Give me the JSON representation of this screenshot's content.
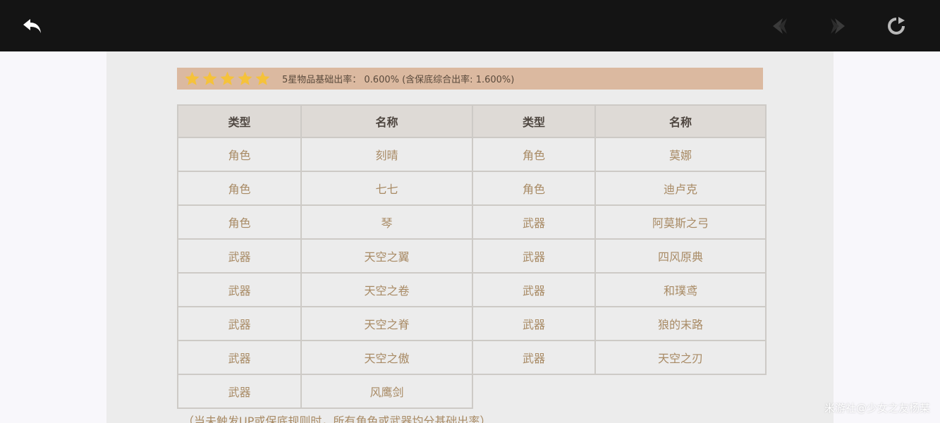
{
  "toolbar": {
    "back_icon": "back-arrow-icon",
    "prev_icon": "prev-arrow-icon",
    "next_icon": "next-arrow-icon",
    "refresh_icon": "refresh-icon"
  },
  "banner": {
    "stars": 5,
    "star_color": "#f5c23a",
    "text": "5星物品基础出率： 0.600% (含保底综合出率: 1.600%)"
  },
  "table": {
    "headers": [
      "类型",
      "名称",
      "类型",
      "名称"
    ],
    "rows": [
      [
        "角色",
        "刻晴",
        "角色",
        "莫娜"
      ],
      [
        "角色",
        "七七",
        "角色",
        "迪卢克"
      ],
      [
        "角色",
        "琴",
        "武器",
        "阿莫斯之弓"
      ],
      [
        "武器",
        "天空之翼",
        "武器",
        "四风原典"
      ],
      [
        "武器",
        "天空之卷",
        "武器",
        "和璞鸢"
      ],
      [
        "武器",
        "天空之脊",
        "武器",
        "狼的末路"
      ],
      [
        "武器",
        "天空之傲",
        "武器",
        "天空之刃"
      ],
      [
        "武器",
        "风鹰剑",
        "",
        ""
      ]
    ]
  },
  "footnote": "（当未触发UP或保底规则时，所有角色或武器均分基础出率）",
  "watermark": "米游社@少女之友杨某"
}
